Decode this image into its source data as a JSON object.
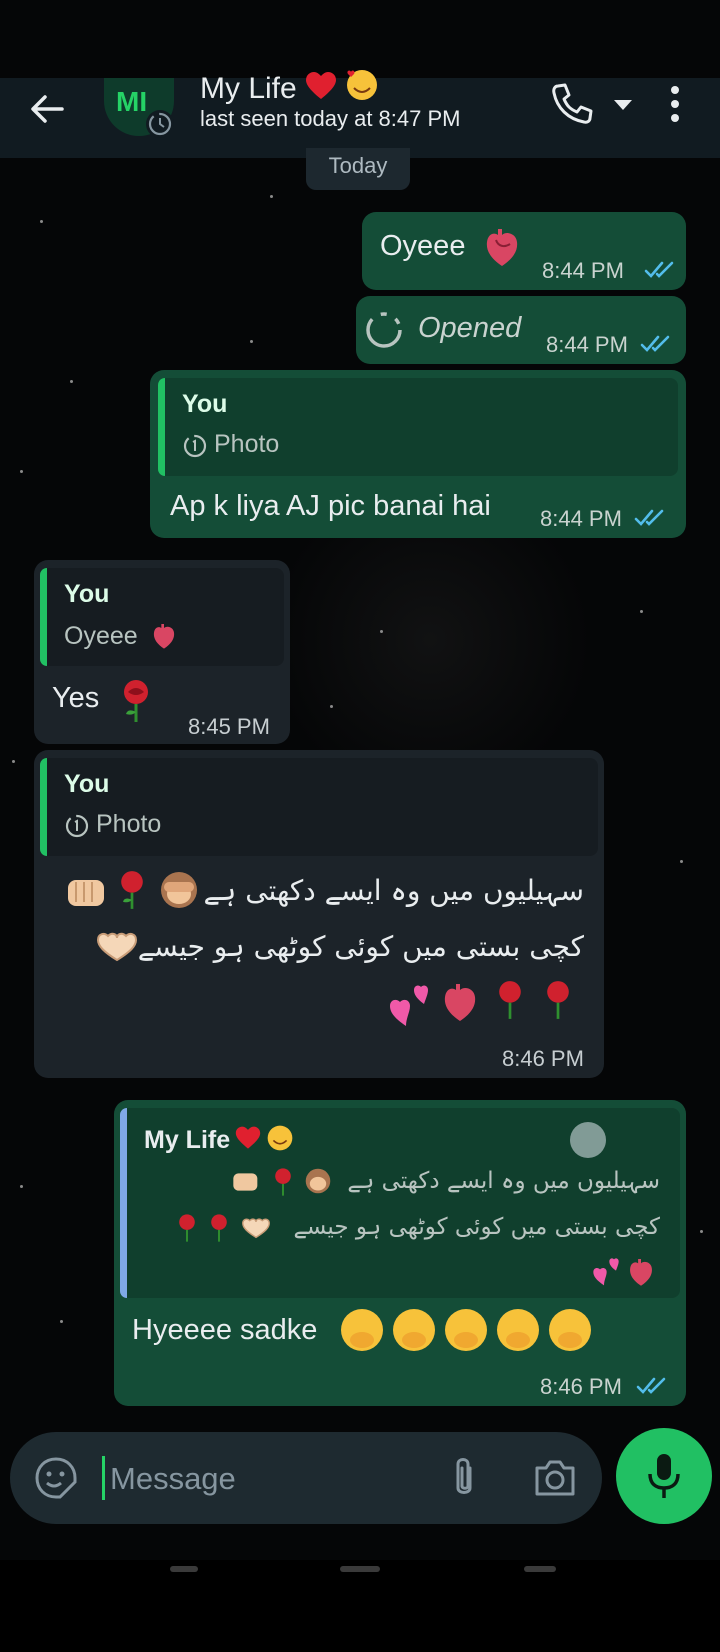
{
  "header": {
    "contact_name": "My Life",
    "avatar_initials": "MI",
    "last_seen": "last seen today at 8:47 PM"
  },
  "date_chip": "Today",
  "messages": [
    {
      "type": "out",
      "text": "Oyeee",
      "time": "8:44 PM",
      "status": "read"
    },
    {
      "type": "out",
      "text": "Opened",
      "time": "8:44 PM",
      "status": "read",
      "kind": "view-once-opened"
    },
    {
      "type": "out",
      "quote_author": "You",
      "quote_text": "Photo",
      "text": "Ap k liya AJ pic banai hai",
      "time": "8:44 PM",
      "status": "read"
    },
    {
      "type": "in",
      "quote_author": "You",
      "quote_text": "Oyeee",
      "text": "Yes",
      "time": "8:45 PM"
    },
    {
      "type": "in",
      "quote_author": "You",
      "quote_text": "Photo",
      "line1": "سہیلیوں میں وہ ایسے دکھتی ہے",
      "line2": "کچی بستی میں کوئی کوٹھی ہو جیسے",
      "time": "8:46 PM"
    },
    {
      "type": "out",
      "quote_author": "My Life",
      "quote_line1": "سہیلیوں میں وہ ایسے دکھتی ہے",
      "quote_line2": "کچی بستی میں کوئی کوٹھی ہو جیسے",
      "text": "Hyeeee sadke",
      "time": "8:46 PM",
      "status": "read"
    }
  ],
  "input": {
    "placeholder": "Message"
  },
  "colors": {
    "outgoing_bubble": "#144d37",
    "incoming_bubble": "#1c2329",
    "accent_green": "#21c063",
    "read_ticks": "#53bdeb"
  }
}
